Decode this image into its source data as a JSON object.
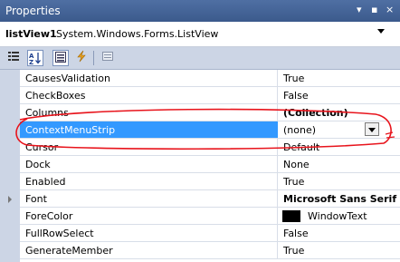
{
  "window": {
    "title": "Properties",
    "pin_glyph": "▾ ▪ ×"
  },
  "object": {
    "name": "listView1",
    "type": "System.Windows.Forms.ListView"
  },
  "toolbar": {
    "buttons": [
      "categorized-icon",
      "alphabetical-icon",
      "properties-icon",
      "events-icon",
      "property-pages-icon"
    ],
    "alphabetical_selected": true
  },
  "properties": [
    {
      "name": "CausesValidation",
      "value": "True",
      "bold": false
    },
    {
      "name": "CheckBoxes",
      "value": "False",
      "bold": false
    },
    {
      "name": "Columns",
      "value": "(Collection)",
      "bold": true
    },
    {
      "name": "ContextMenuStrip",
      "value": "(none)",
      "bold": false,
      "selected": true,
      "has_dropdown": true
    },
    {
      "name": "Cursor",
      "value": "Default",
      "bold": false
    },
    {
      "name": "Dock",
      "value": "None",
      "bold": false
    },
    {
      "name": "Enabled",
      "value": "True",
      "bold": false
    },
    {
      "name": "Font",
      "value": "Microsoft Sans Serif",
      "bold": true,
      "expandable": true
    },
    {
      "name": "ForeColor",
      "value": "WindowText",
      "bold": false,
      "color_swatch": "#000000"
    },
    {
      "name": "FullRowSelect",
      "value": "False",
      "bold": false
    },
    {
      "name": "GenerateMember",
      "value": "True",
      "bold": false
    }
  ],
  "colors": {
    "title_bar": "#3b5a8c",
    "selection": "#3399ff",
    "annotation": "#e8141c"
  }
}
